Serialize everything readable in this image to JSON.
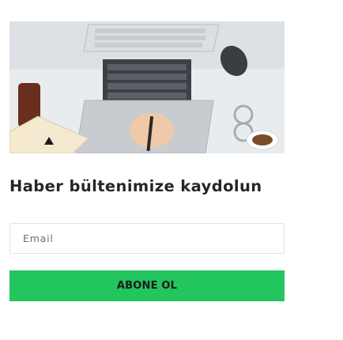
{
  "newsletter": {
    "title": "Haber bültenimize kaydolun",
    "email_placeholder": "Email",
    "subscribe_label": "ABONE OL"
  },
  "hero_image": {
    "alt": "Masada laptop, defter ve telefon"
  },
  "colors": {
    "button": "#22c55e",
    "title": "#262626",
    "input_border": "#e3e3e3"
  }
}
